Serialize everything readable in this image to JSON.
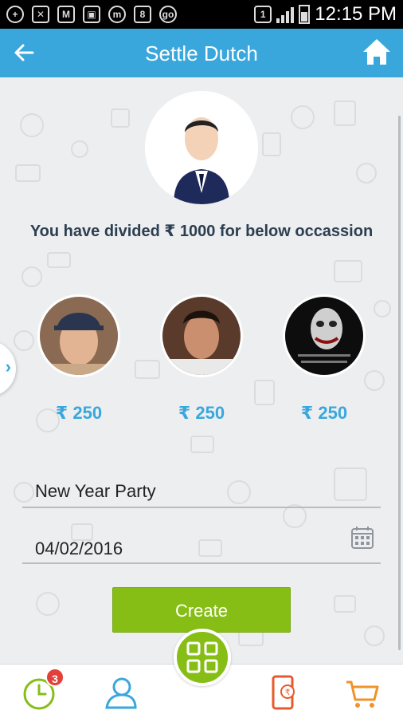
{
  "statusbar": {
    "time": "12:15 PM"
  },
  "appbar": {
    "title": "Settle Dutch"
  },
  "headline": "You have divided ₹ 1000 for below occassion",
  "members": [
    {
      "amount": "₹ 250"
    },
    {
      "amount": "₹ 250"
    },
    {
      "amount": "₹ 250"
    }
  ],
  "form": {
    "occasion_value": "New Year Party",
    "date_value": "04/02/2016"
  },
  "create_label": "Create",
  "bottomnav": {
    "badge_count": "3"
  },
  "colors": {
    "primary": "#3aa7dc",
    "accent": "#86be16",
    "badge": "#e3403a",
    "cart": "#f0932b"
  }
}
